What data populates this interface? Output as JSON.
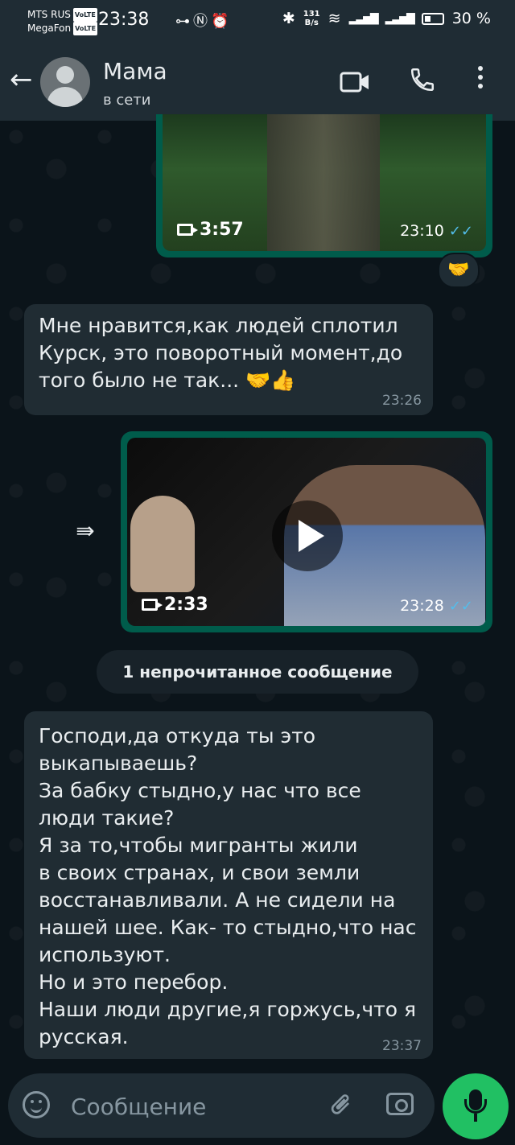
{
  "status_bar": {
    "carrier1": "MTS RUS",
    "carrier2": "MegaFon",
    "volte": "VoLTE",
    "time": "23:38",
    "net_speed_value": "131",
    "net_speed_unit": "B/s",
    "battery": "30 %"
  },
  "header": {
    "contact_name": "Мама",
    "status": "в сети"
  },
  "messages": [
    {
      "type": "video",
      "direction": "out",
      "duration": "3:57",
      "time": "23:10",
      "read": true,
      "reaction": "🤝"
    },
    {
      "type": "text",
      "direction": "in",
      "text": "Мне нравится,как людей сплотил\nКурск, это поворотный момент,до\nтого было не так... 🤝👍",
      "time": "23:26"
    },
    {
      "type": "video",
      "direction": "out",
      "forwarded": true,
      "duration": "2:33",
      "time": "23:28",
      "read": true
    },
    {
      "type": "unread_divider",
      "label": "1 непрочитанное сообщение"
    },
    {
      "type": "text",
      "direction": "in",
      "text": "Господи,да откуда ты это\nвыкапываешь?\nЗа бабку стыдно,у нас что все\nлюди такие?\nЯ за то,чтобы мигранты жили\nв своих странах, и свои земли\nвосстанавливали. А не сидели на\nнашей шее. Как- то стыдно,что нас\nиспользуют.\nНо и это перебор.\nНаши люди другие,я горжусь,что я\nрусская.",
      "time": "23:37"
    }
  ],
  "composer": {
    "placeholder": "Сообщение"
  },
  "colors": {
    "background": "#0b141a",
    "header": "#1f2c34",
    "incoming_bubble": "#202c33",
    "outgoing_bubble": "#005c4b",
    "accent_green": "#21c063",
    "read_ticks": "#53bdeb"
  },
  "icons": {
    "back": "arrow-left-icon",
    "video_call": "video-camera-icon",
    "voice_call": "phone-icon",
    "more": "more-vertical-icon",
    "forward": "forward-icon",
    "emoji": "emoji-icon",
    "attach": "paperclip-icon",
    "camera": "camera-icon",
    "mic": "microphone-icon"
  }
}
